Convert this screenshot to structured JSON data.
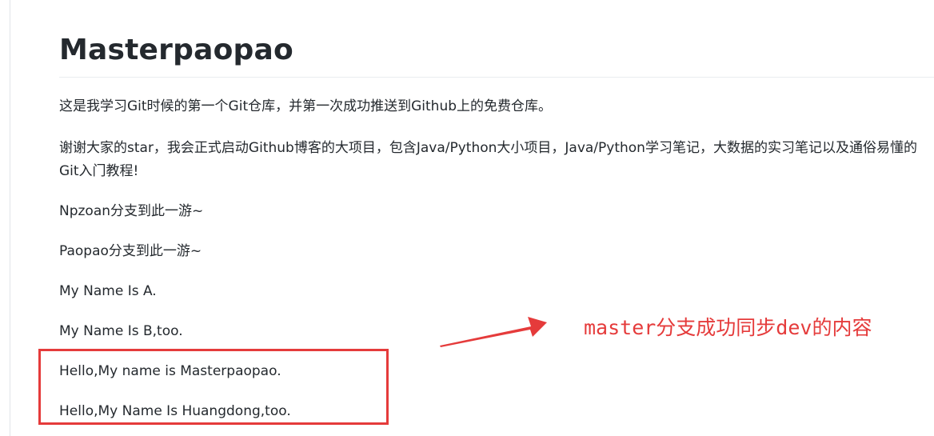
{
  "readme": {
    "title": "Masterpaopao",
    "paragraphs": [
      "这是我学习Git时候的第一个Git仓库，并第一次成功推送到Github上的免费仓库。",
      "谢谢大家的star，我会正式启动Github博客的大项目，包含Java/Python大小项目，Java/Python学习笔记，大数据的实习笔记以及通俗易懂的Git入门教程!",
      "Npzoan分支到此一游~",
      "Paopao分支到此一游~",
      "My Name Is A.",
      "My Name Is B,too.",
      "Hello,My name is Masterpaopao.",
      "Hello,My Name Is Huangdong,too."
    ]
  },
  "annotation": {
    "text": "master分支成功同步dev的内容",
    "color": "#e53b3b"
  }
}
